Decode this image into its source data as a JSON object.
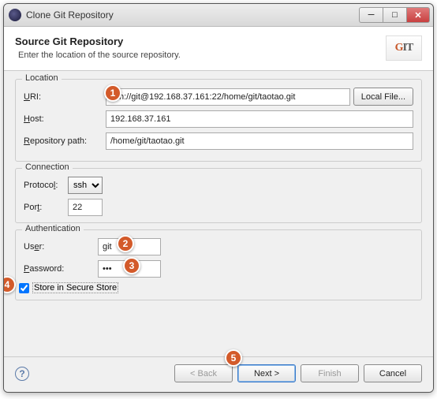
{
  "window": {
    "title": "Clone Git Repository"
  },
  "header": {
    "title": "Source Git Repository",
    "subtitle": "Enter the location of the source repository.",
    "logo_text": "GIT"
  },
  "location": {
    "group_label": "Location",
    "uri_label": "URI:",
    "uri_value": "ssh://git@192.168.37.161:22/home/git/taotao.git",
    "local_file_label": "Local File...",
    "host_label": "Host:",
    "host_value": "192.168.37.161",
    "repo_label": "Repository path:",
    "repo_value": "/home/git/taotao.git"
  },
  "connection": {
    "group_label": "Connection",
    "protocol_label": "Protocol:",
    "protocol_value": "ssh",
    "port_label": "Port:",
    "port_value": "22"
  },
  "auth": {
    "group_label": "Authentication",
    "user_label": "User:",
    "user_value": "git",
    "password_label": "Password:",
    "password_value": "•••",
    "store_label": "Store in Secure Store",
    "store_checked": true
  },
  "footer": {
    "back_label": "< Back",
    "next_label": "Next >",
    "finish_label": "Finish",
    "cancel_label": "Cancel"
  },
  "callouts": [
    "1",
    "2",
    "3",
    "4",
    "5"
  ]
}
